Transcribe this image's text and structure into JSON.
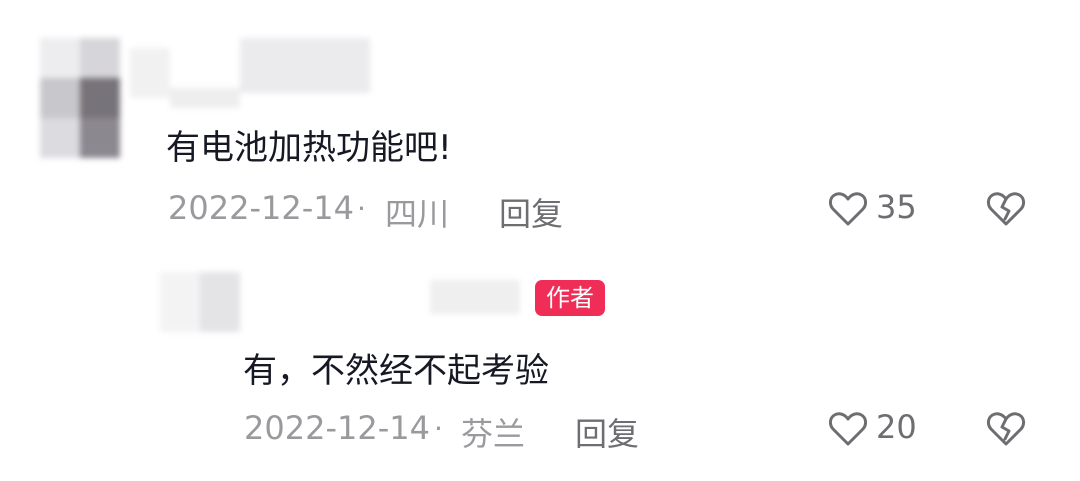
{
  "comment": {
    "text": "有电池加热功能吧!",
    "date": "2022-12-14",
    "location": "四川",
    "reply_label": "回复",
    "likes": "35"
  },
  "reply": {
    "author_badge": "作者",
    "text": "有，不然经不起考验",
    "date": "2022-12-14",
    "location": "芬兰",
    "reply_label": "回复",
    "likes": "20"
  },
  "separator": "·",
  "icons": {
    "like": "heart-icon",
    "dislike": "broken-heart-icon"
  }
}
